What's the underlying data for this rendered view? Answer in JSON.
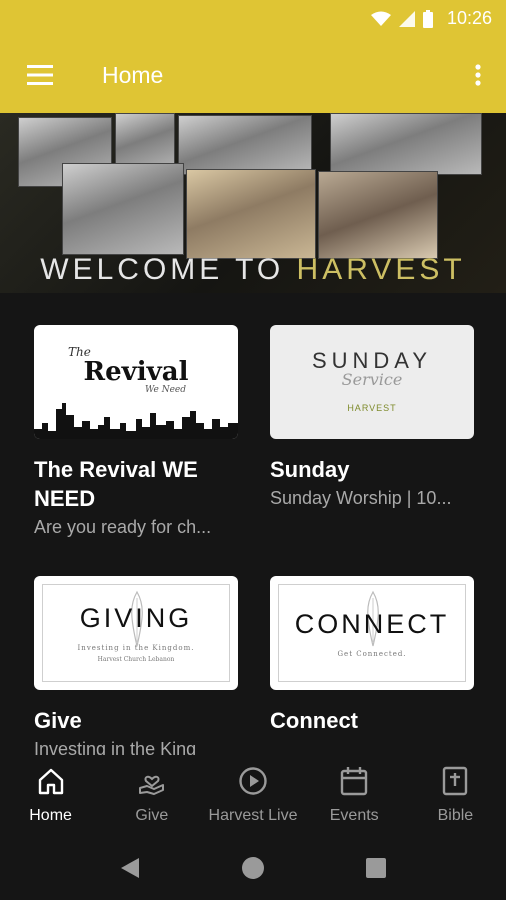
{
  "status": {
    "time": "10:26"
  },
  "app_bar": {
    "title": "Home",
    "menu_icon": "menu-icon",
    "overflow_icon": "more-vert-icon"
  },
  "hero": {
    "caption_welcome": "WELCOME TO ",
    "caption_name": "HARVEST",
    "caption_color": "#cdbf63"
  },
  "cards": [
    {
      "thumb_word": "Revival",
      "thumb_the": "The",
      "thumb_sub": "We Need",
      "title": "The Revival WE NEED",
      "subtitle": "Are you ready for ch..."
    },
    {
      "thumb_word": "SUNDAY",
      "thumb_script": "Service",
      "thumb_logo": "HARVEST",
      "title": "Sunday",
      "subtitle": "Sunday Worship | 10..."
    },
    {
      "thumb_word": "GIVING",
      "thumb_sub": "Investing in the Kingdom.",
      "thumb_sub2": "Harvest Church Lebanon",
      "title": "Give",
      "subtitle": "Investing in the King"
    },
    {
      "thumb_word": "CONNECT",
      "thumb_sub": "Get Connected.",
      "title": "Connect",
      "subtitle": ""
    }
  ],
  "nav": [
    {
      "label": "Home",
      "icon": "home-icon",
      "active": true
    },
    {
      "label": "Give",
      "icon": "give-hand-heart-icon",
      "active": false
    },
    {
      "label": "Harvest Live",
      "icon": "play-circle-icon",
      "active": false
    },
    {
      "label": "Events",
      "icon": "calendar-icon",
      "active": false
    },
    {
      "label": "Bible",
      "icon": "bible-icon",
      "active": false
    }
  ],
  "colors": {
    "accent": "#dfc534",
    "background": "#151515",
    "inactive": "#9a9a9a"
  }
}
